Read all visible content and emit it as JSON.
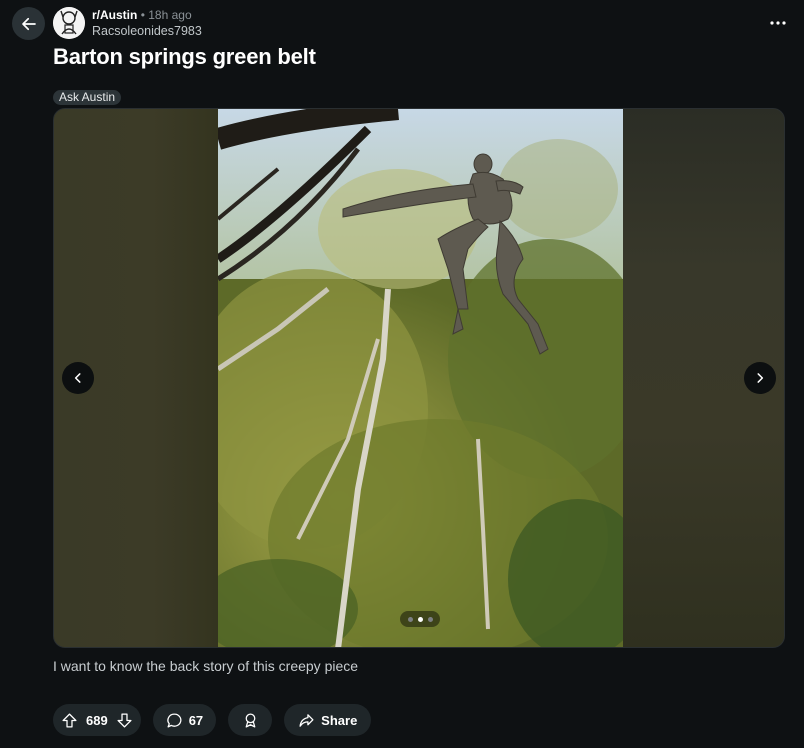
{
  "post": {
    "subreddit": "r/Austin",
    "separator": "•",
    "time_ago": "18h ago",
    "author": "Racsoleonides7983",
    "title": "Barton springs green belt",
    "flair": "Ask Austin",
    "body": "I want to know the back story of this creepy piece"
  },
  "gallery": {
    "image_count": 3,
    "current_index": 2
  },
  "actions": {
    "vote_count": "689",
    "comment_count": "67",
    "share_label": "Share"
  },
  "icons": [
    "back-arrow-icon",
    "subreddit-avatar",
    "more-options-icon",
    "chevron-left-icon",
    "chevron-right-icon",
    "upvote-icon",
    "downvote-icon",
    "comment-icon",
    "award-icon",
    "share-icon"
  ],
  "colors": {
    "background": "#0e1113",
    "button_background": "#1f2629",
    "text_primary": "#ffffff",
    "text_muted": "#8b9297"
  }
}
